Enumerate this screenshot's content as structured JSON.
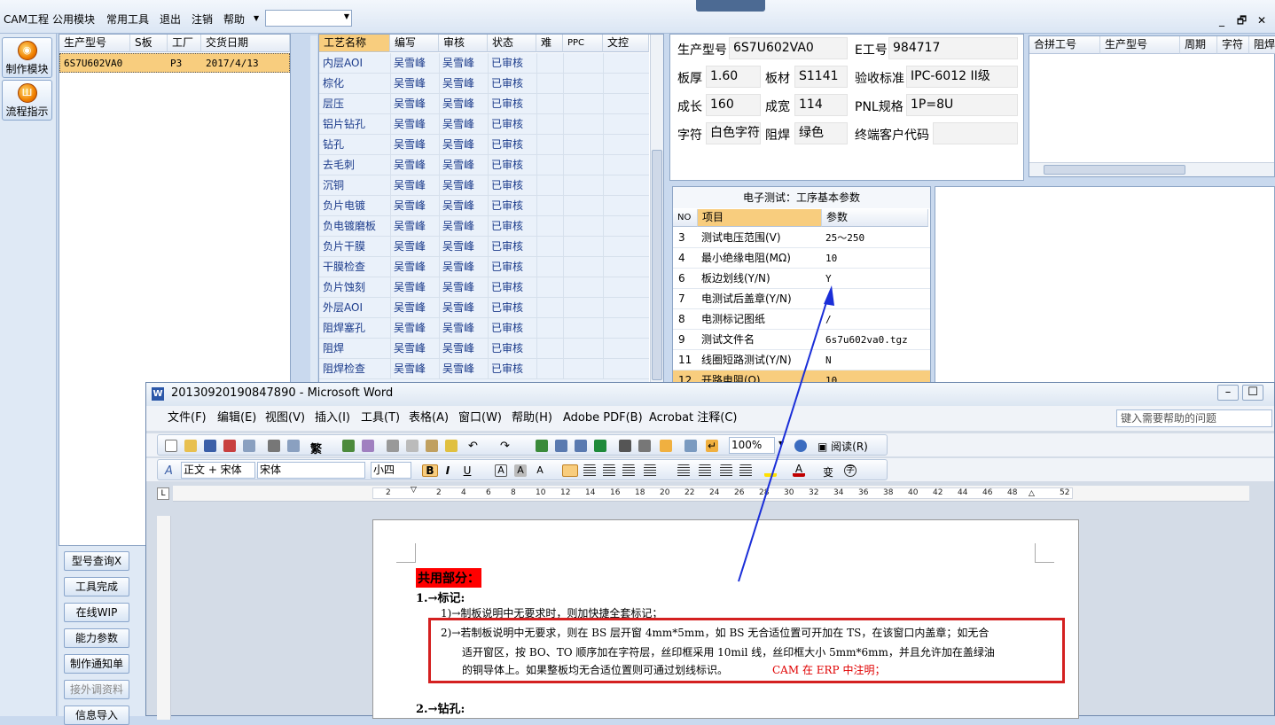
{
  "app": {
    "menu": [
      "CAM工程",
      "公用模块",
      "常用工具",
      "退出",
      "注销",
      "帮助"
    ],
    "window_controls": [
      "_",
      "🗗",
      "✕"
    ]
  },
  "leftnav": {
    "btn1": "制作模块",
    "btn2": "流程指示"
  },
  "orders": {
    "headers": [
      "生产型号",
      "S板",
      "工厂",
      "交货日期"
    ],
    "rows": [
      [
        "6S7U602VA0",
        "",
        "P3",
        "2017/4/13"
      ]
    ]
  },
  "funcs": [
    "型号查询X",
    "工具完成",
    "在线WIP",
    "能力参数",
    "制作通知单",
    "接外调资料",
    "信息导入"
  ],
  "process": {
    "headers": [
      "工艺名称",
      "编写",
      "审核",
      "状态",
      "难",
      "PPC",
      "文控"
    ],
    "rows": [
      [
        "内层AOI",
        "吴雪峰",
        "吴雪峰",
        "已审核"
      ],
      [
        "棕化",
        "吴雪峰",
        "吴雪峰",
        "已审核"
      ],
      [
        "层压",
        "吴雪峰",
        "吴雪峰",
        "已审核"
      ],
      [
        "铝片钻孔",
        "吴雪峰",
        "吴雪峰",
        "已审核"
      ],
      [
        "钻孔",
        "吴雪峰",
        "吴雪峰",
        "已审核"
      ],
      [
        "去毛刺",
        "吴雪峰",
        "吴雪峰",
        "已审核"
      ],
      [
        "沉铜",
        "吴雪峰",
        "吴雪峰",
        "已审核"
      ],
      [
        "负片电镀",
        "吴雪峰",
        "吴雪峰",
        "已审核"
      ],
      [
        "负电镀磨板",
        "吴雪峰",
        "吴雪峰",
        "已审核"
      ],
      [
        "负片干膜",
        "吴雪峰",
        "吴雪峰",
        "已审核"
      ],
      [
        "干膜检查",
        "吴雪峰",
        "吴雪峰",
        "已审核"
      ],
      [
        "负片蚀刻",
        "吴雪峰",
        "吴雪峰",
        "已审核"
      ],
      [
        "外层AOI",
        "吴雪峰",
        "吴雪峰",
        "已审核"
      ],
      [
        "阻焊塞孔",
        "吴雪峰",
        "吴雪峰",
        "已审核"
      ],
      [
        "阻焊",
        "吴雪峰",
        "吴雪峰",
        "已审核"
      ],
      [
        "阻焊检查",
        "吴雪峰",
        "吴雪峰",
        "已审核"
      ]
    ]
  },
  "info": {
    "model_label": "生产型号",
    "model": "6S7U602VA0",
    "e_label": "E工号",
    "e": "984717",
    "thick_label": "板厚",
    "thick": "1.60",
    "mat_label": "板材",
    "mat": "S1141",
    "std_label": "验收标准",
    "std": "IPC-6012 II级",
    "len_label": "成长",
    "len": "160",
    "wid_label": "成宽",
    "wid": "114",
    "pnl_label": "PNL规格",
    "pnl": "1P=8U",
    "char_label": "字符",
    "char": "白色字符",
    "mask_label": "阻焊",
    "mask": "绿色",
    "cust_label": "终端客户代码",
    "cust": ""
  },
  "merge": {
    "headers": [
      "合拼工号",
      "生产型号",
      "周期",
      "字符",
      "阻焊"
    ]
  },
  "params": {
    "title": "电子测试：工序基本参数",
    "headers": [
      "NO",
      "项目",
      "参数"
    ],
    "rows": [
      [
        "3",
        "测试电压范围(V)",
        "25～250"
      ],
      [
        "4",
        "最小绝缘电阻(MΩ)",
        "10"
      ],
      [
        "6",
        "板边划线(Y/N)",
        "Y"
      ],
      [
        "7",
        "电测试后盖章(Y/N)",
        ""
      ],
      [
        "8",
        "电测标记图纸",
        "/"
      ],
      [
        "9",
        "测试文件名",
        "6s7u602va0.tgz"
      ],
      [
        "11",
        "线圈短路测试(Y/N)",
        "N"
      ],
      [
        "12",
        "开路电阻(Ω)",
        "10"
      ]
    ]
  },
  "word": {
    "title": "20130920190847890 - Microsoft Word",
    "menu": [
      "文件(F)",
      "编辑(E)",
      "视图(V)",
      "插入(I)",
      "工具(T)",
      "表格(A)",
      "窗口(W)",
      "帮助(H)",
      "Adobe PDF(B)",
      "Acrobat 注释(C)"
    ],
    "help_placeholder": "键入需要帮助的问题",
    "zoom": "100%",
    "read": "阅读(R)",
    "style": "正文 + 宋体",
    "font": "宋体",
    "size": "小四",
    "ruler": [
      "2",
      "2",
      "4",
      "6",
      "8",
      "10",
      "12",
      "14",
      "16",
      "18",
      "20",
      "22",
      "24",
      "26",
      "28",
      "30",
      "32",
      "34",
      "36",
      "38",
      "40",
      "42",
      "44",
      "46",
      "48",
      "52"
    ],
    "doc": {
      "heading": "共用部分：",
      "s1": "1.→标记:",
      "p1": "1)→制板说明中无要求时，则加快捷全套标记；",
      "p2a": "2)→若制板说明中无要求，则在 BS 层开窗 4mm*5mm，如 BS 无合适位置可开加在 TS，在该窗口内盖章；如无合",
      "p2b": "适开窗区，按 BO、TO 顺序加在字符层，丝印框采用 10mil 线，丝印框大小 5mm*6mm，并且允许加在盖绿油",
      "p2c": "的铜导体上。如果整板均无合适位置则可通过划线标识。",
      "p2red": "CAM 在 ERP 中注明；",
      "s2": "2.→钻孔:"
    }
  },
  "colors": {
    "accent": "#f8cd7e",
    "highlight": "#ff0000",
    "arrow": "#1a2ed8",
    "box": "#d42020"
  }
}
